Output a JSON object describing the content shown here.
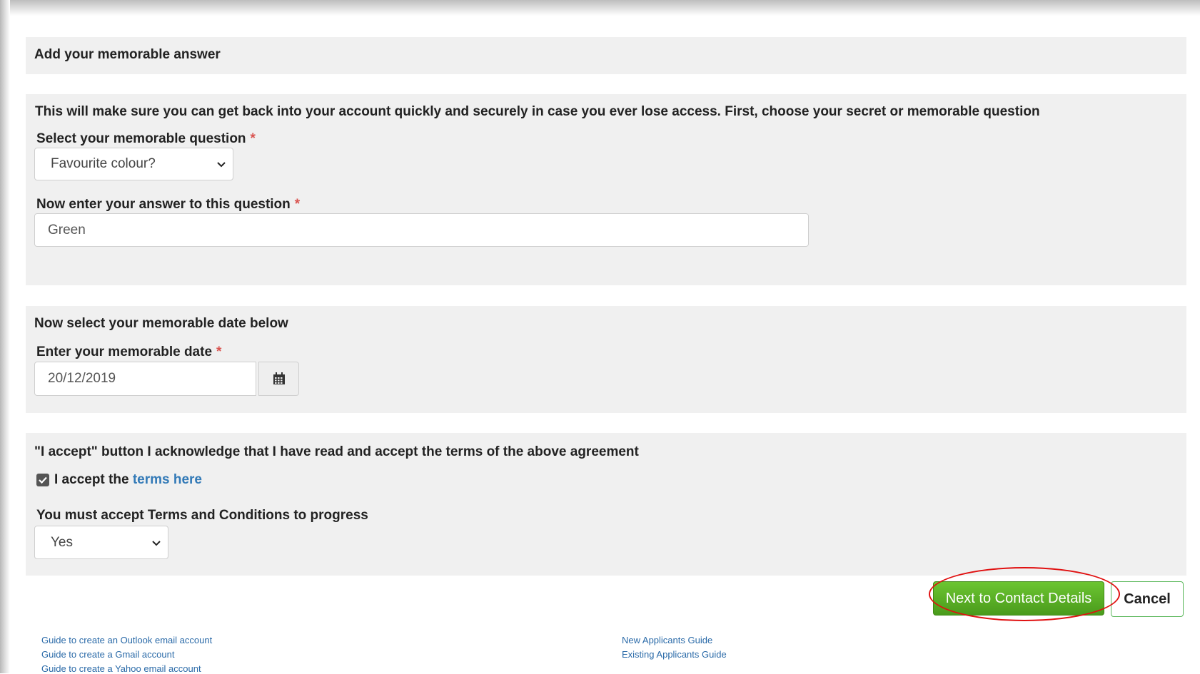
{
  "header": {
    "title": "Add your memorable answer"
  },
  "question_section": {
    "intro": "This will make sure you can get back into your account quickly and securely in case you ever lose access. First, choose your secret or memorable question",
    "question_label": "Select your memorable question",
    "question_value": "Favourite colour?",
    "answer_label": "Now enter your answer to this question",
    "answer_value": "Green",
    "required_mark": "*"
  },
  "date_section": {
    "heading": "Now select your memorable date below",
    "date_label": "Enter your memorable date",
    "date_value": "20/12/2019",
    "required_mark": "*"
  },
  "terms_section": {
    "heading": "\"I accept\" button I acknowledge that I have read and accept the terms of the above agreement",
    "checkbox_checked": true,
    "accept_prefix": "I accept the",
    "terms_link": "terms here",
    "must_accept_label": "You must accept Terms and Conditions to progress",
    "must_accept_value": "Yes"
  },
  "actions": {
    "next_label": "Next to Contact Details",
    "cancel_label": "Cancel"
  },
  "footer": {
    "left_links": [
      "Guide to create an Outlook email account",
      "Guide to create a Gmail account",
      "Guide to create a Yahoo email account"
    ],
    "right_links": [
      "New Applicants Guide",
      "Existing Applicants Guide"
    ]
  },
  "colors": {
    "panel_bg": "#f0f0f0",
    "link_blue": "#337ab7",
    "next_green": "#5cb85c",
    "required_red": "#d9534f",
    "annotation_red": "#e01010"
  }
}
